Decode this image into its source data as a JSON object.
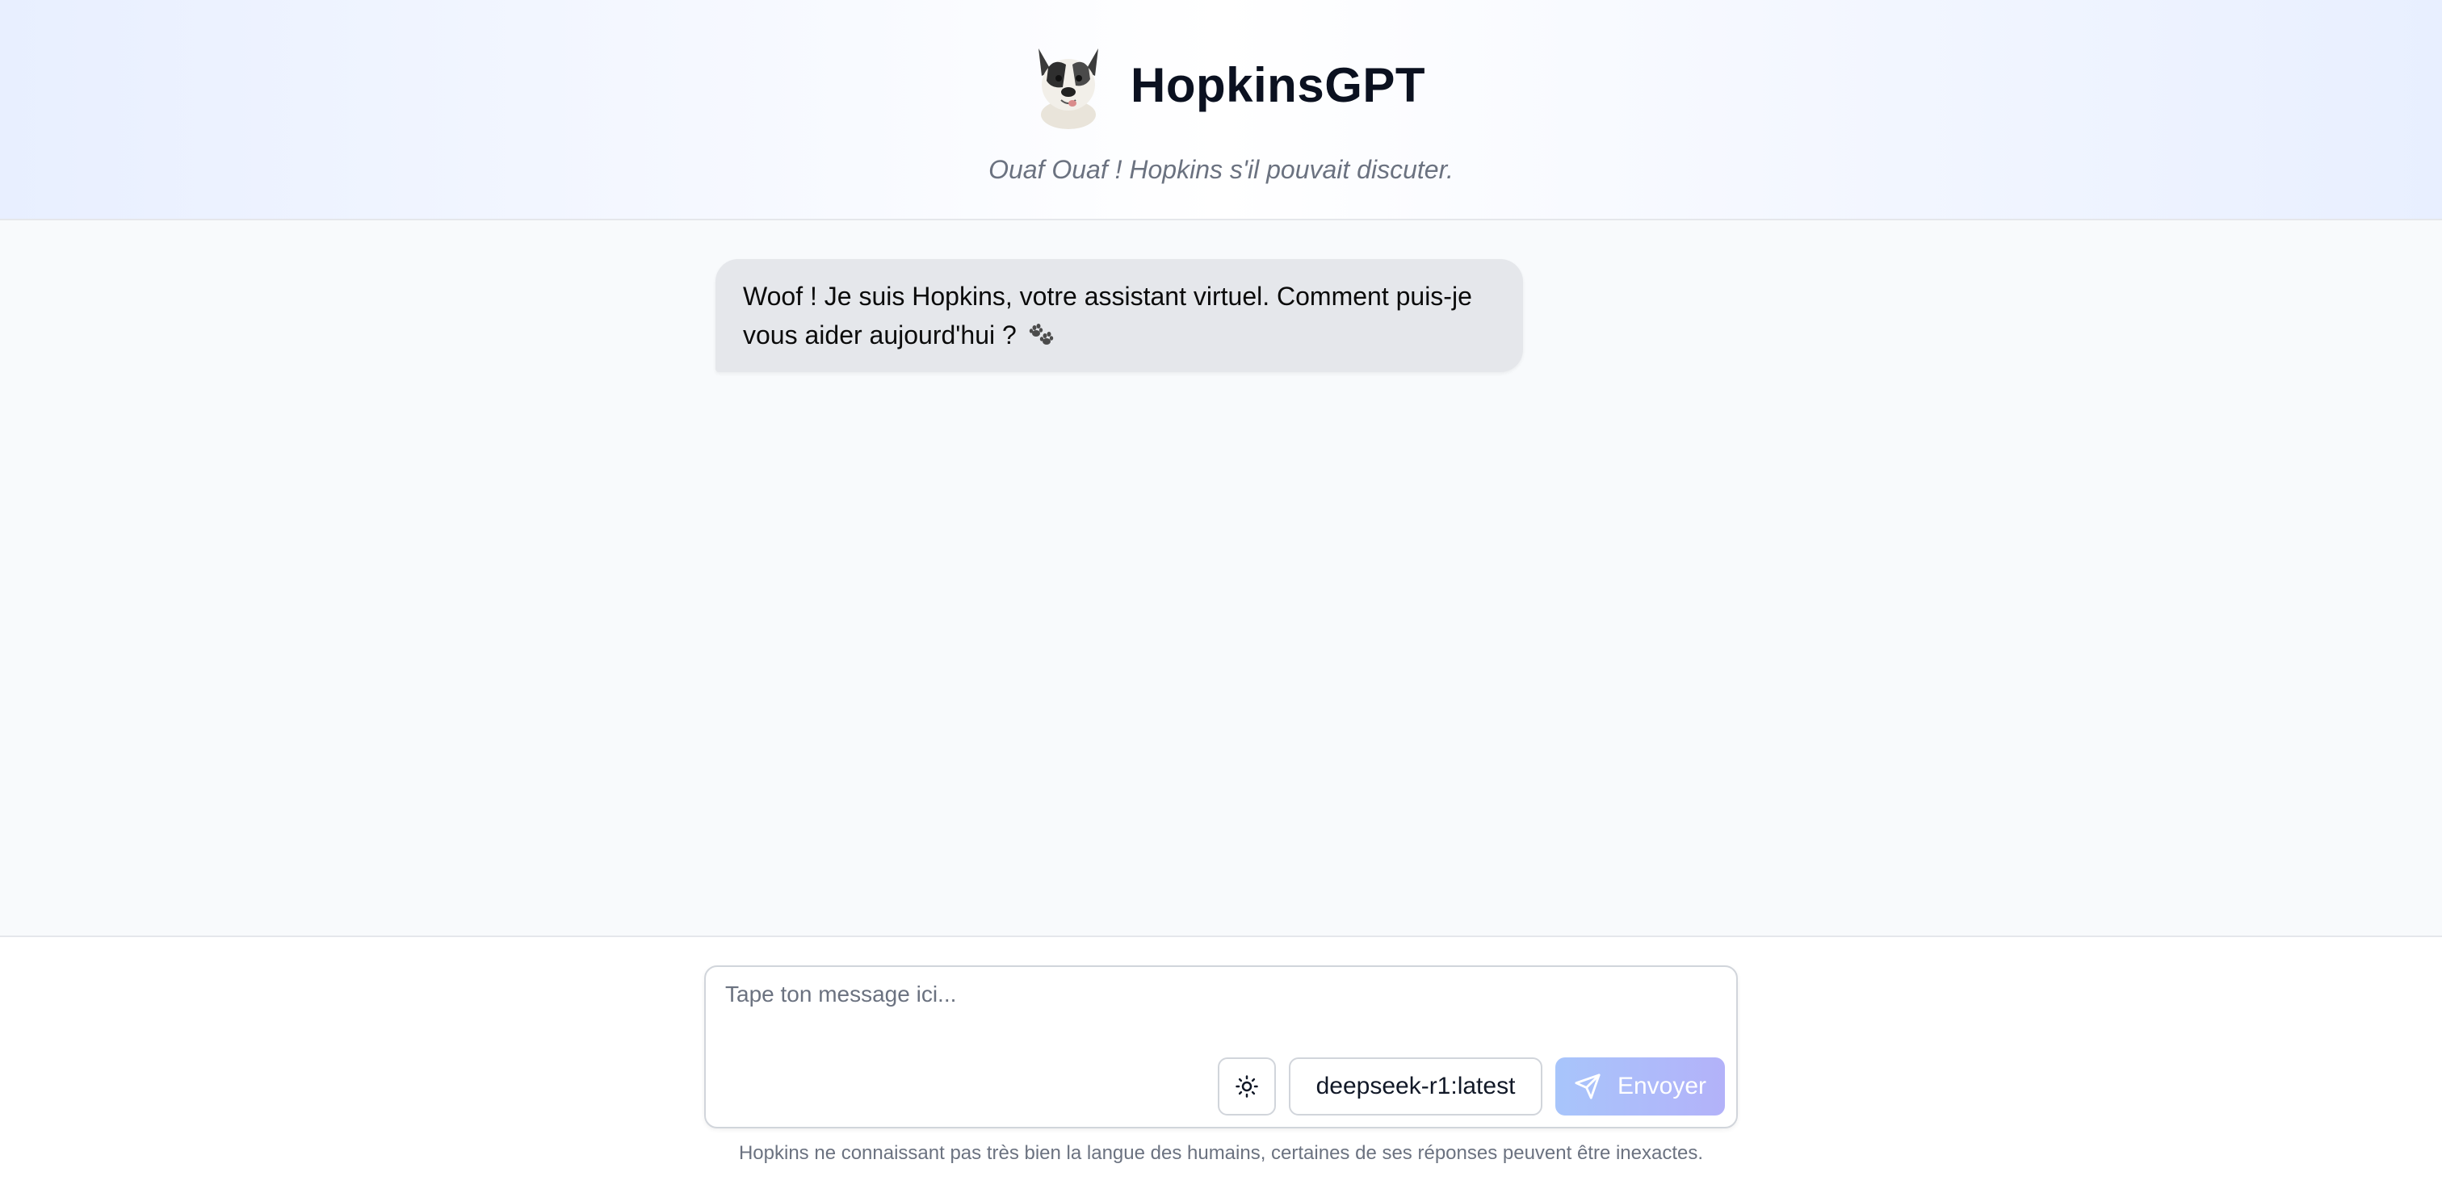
{
  "header": {
    "title": "HopkinsGPT",
    "tagline": "Ouaf Ouaf ! Hopkins s'il pouvait discuter.",
    "logo_icon": "french-bulldog-icon"
  },
  "chat": {
    "messages": [
      {
        "role": "assistant",
        "text": "Woof ! Je suis Hopkins, votre assistant virtuel. Comment puis-je vous aider aujourd'hui ?",
        "emoji_icon": "paw-prints-icon"
      }
    ]
  },
  "composer": {
    "placeholder": "Tape ton message ici...",
    "value": "",
    "theme_icon": "sun-icon",
    "model_label": "deepseek-r1:latest",
    "send_label": "Envoyer",
    "send_icon": "send-icon",
    "send_colors": [
      "#a8c5fb",
      "#b3b2f9"
    ]
  },
  "footer": {
    "disclaimer": "Hopkins ne connaissant pas très bien la langue des humains, certaines de ses réponses peuvent être inexactes."
  }
}
